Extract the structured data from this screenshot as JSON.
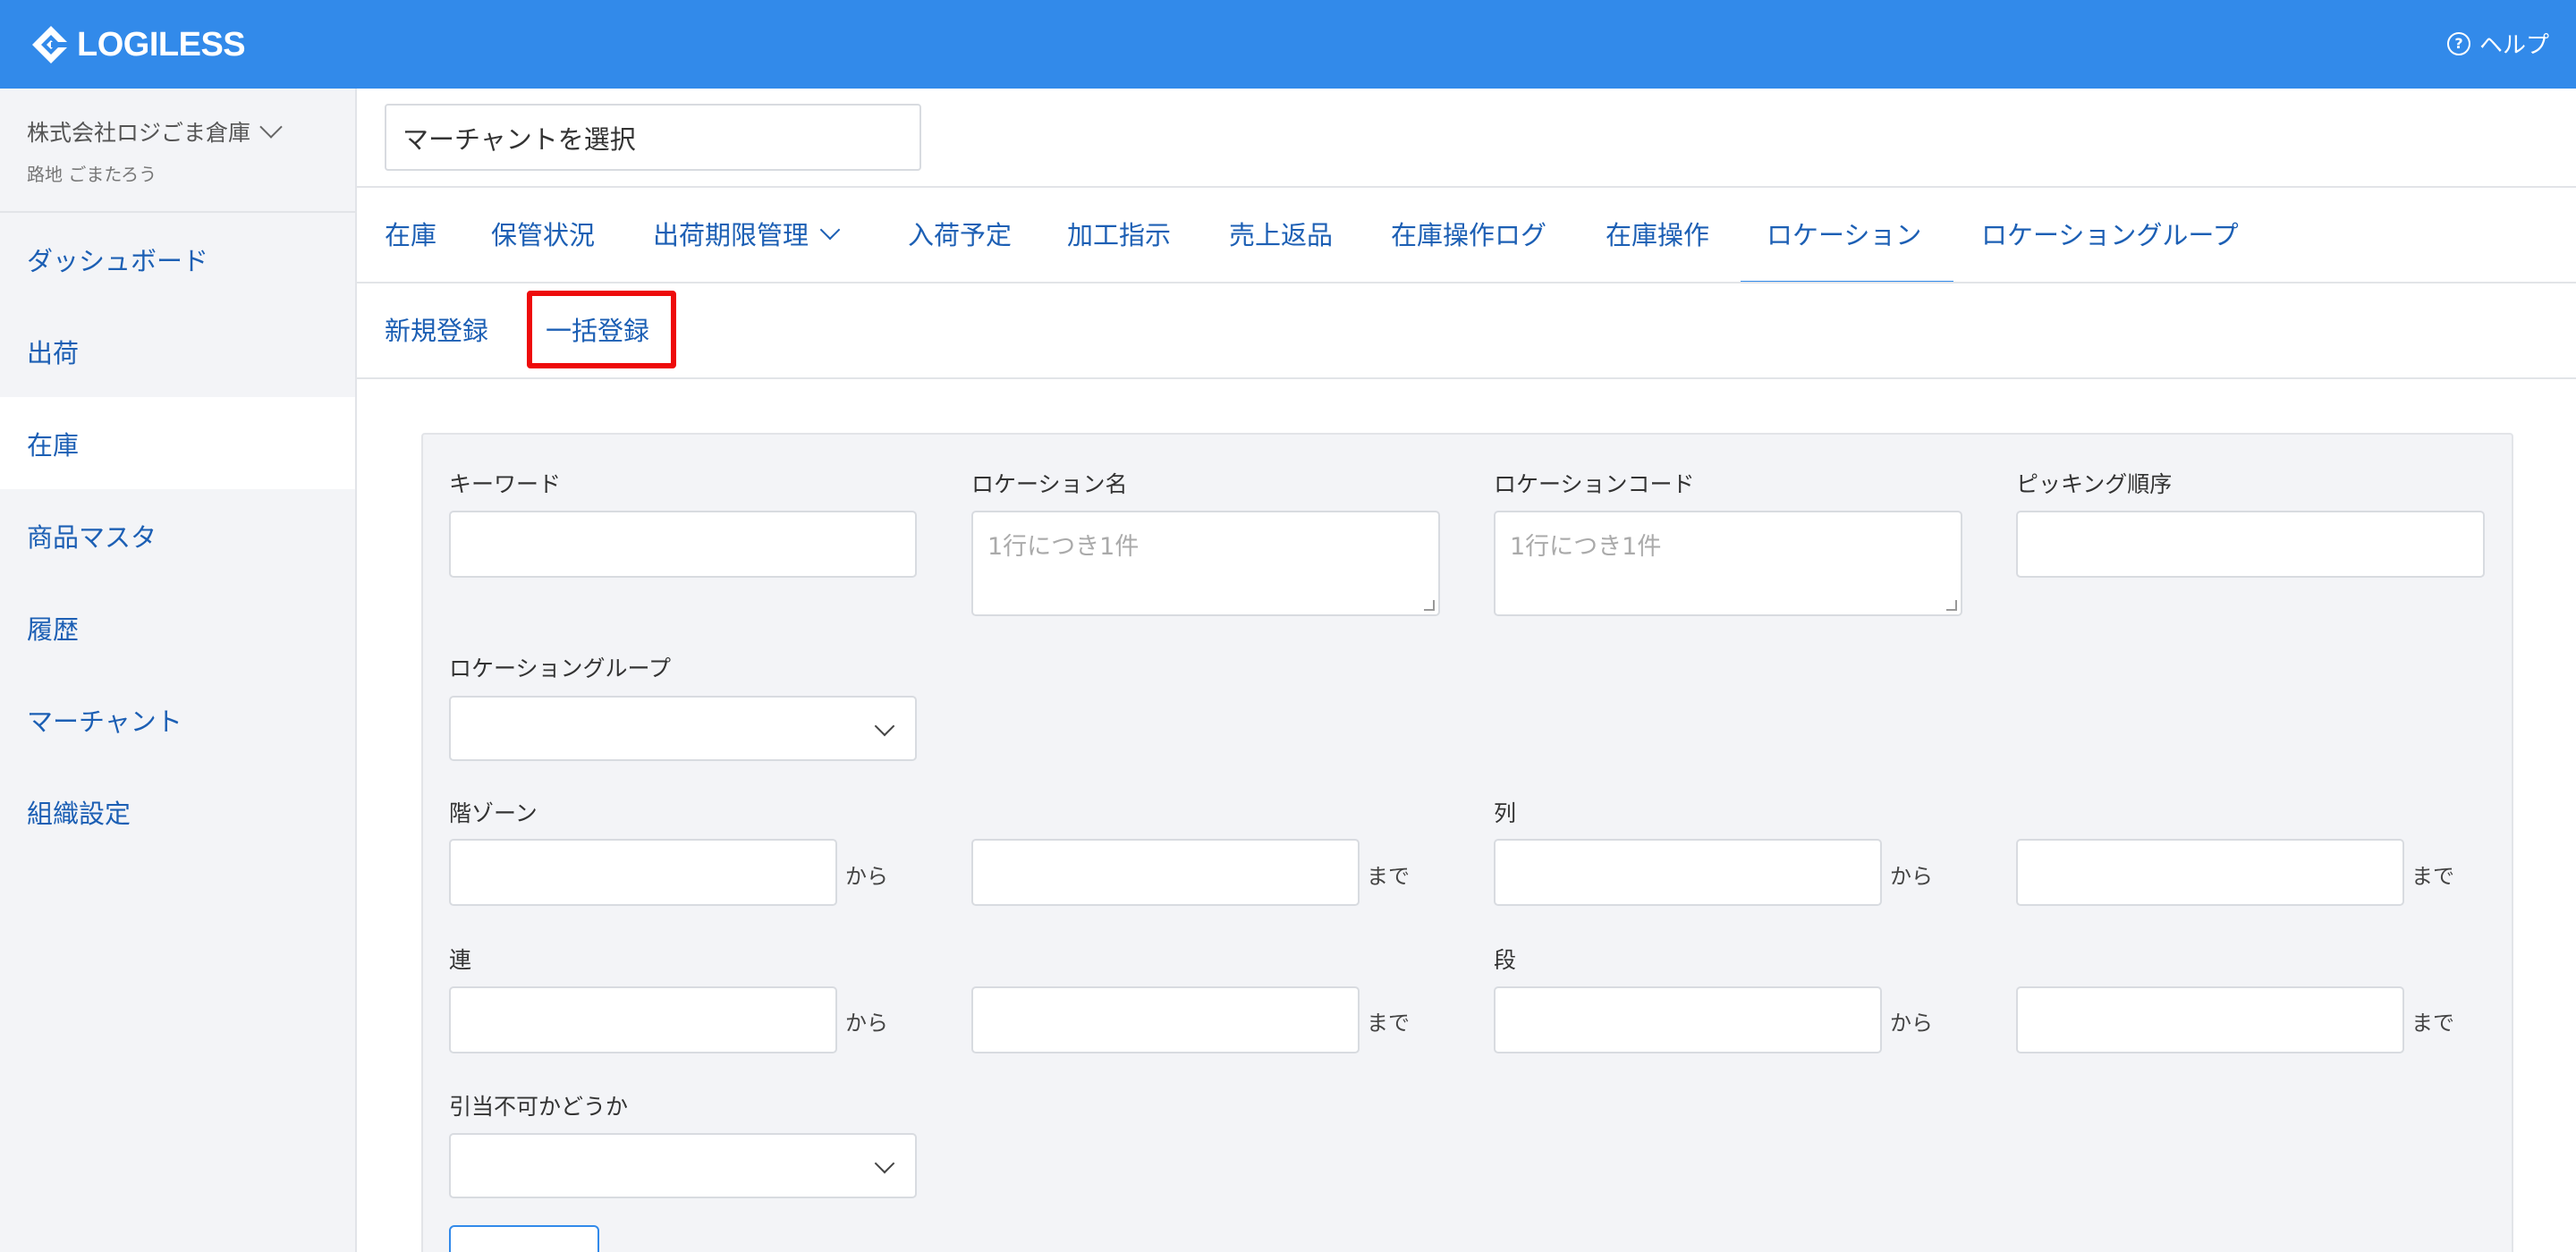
{
  "header": {
    "logo_text": "LOGILESS",
    "help_label": "ヘルプ",
    "help_icon": "?",
    "brand_color": "#328aea"
  },
  "sidebar": {
    "org_name": "株式会社ロジごま倉庫",
    "user_name": "路地 ごまたろう",
    "items": [
      {
        "label": "ダッシュボード"
      },
      {
        "label": "出荷"
      },
      {
        "label": "在庫",
        "active": true
      },
      {
        "label": "商品マスタ"
      },
      {
        "label": "履歴"
      },
      {
        "label": "マーチャント"
      },
      {
        "label": "組織設定"
      }
    ]
  },
  "merchant": {
    "placeholder": "マーチャントを選択"
  },
  "tabs": [
    {
      "label": "在庫"
    },
    {
      "label": "保管状況"
    },
    {
      "label": "出荷期限管理",
      "has_dropdown": true
    },
    {
      "label": "入荷予定"
    },
    {
      "label": "加工指示"
    },
    {
      "label": "売上返品"
    },
    {
      "label": "在庫操作ログ"
    },
    {
      "label": "在庫操作"
    },
    {
      "label": "ロケーション",
      "active": true
    },
    {
      "label": "ロケーショングループ"
    }
  ],
  "subtabs": [
    {
      "label": "新規登録"
    },
    {
      "label": "一括登録",
      "highlighted": true
    }
  ],
  "search": {
    "keyword_label": "キーワード",
    "location_name_label": "ロケーション名",
    "location_name_placeholder": "1行につき1件",
    "location_code_label": "ロケーションコード",
    "location_code_placeholder": "1行につき1件",
    "picking_order_label": "ピッキング順序",
    "location_group_label": "ロケーショングループ",
    "floor_zone_label": "階ゾーン",
    "column_label": "列",
    "ren_label": "連",
    "dan_label": "段",
    "unallocatable_label": "引当不可かどうか",
    "from_suffix": "から",
    "to_suffix": "まで"
  }
}
